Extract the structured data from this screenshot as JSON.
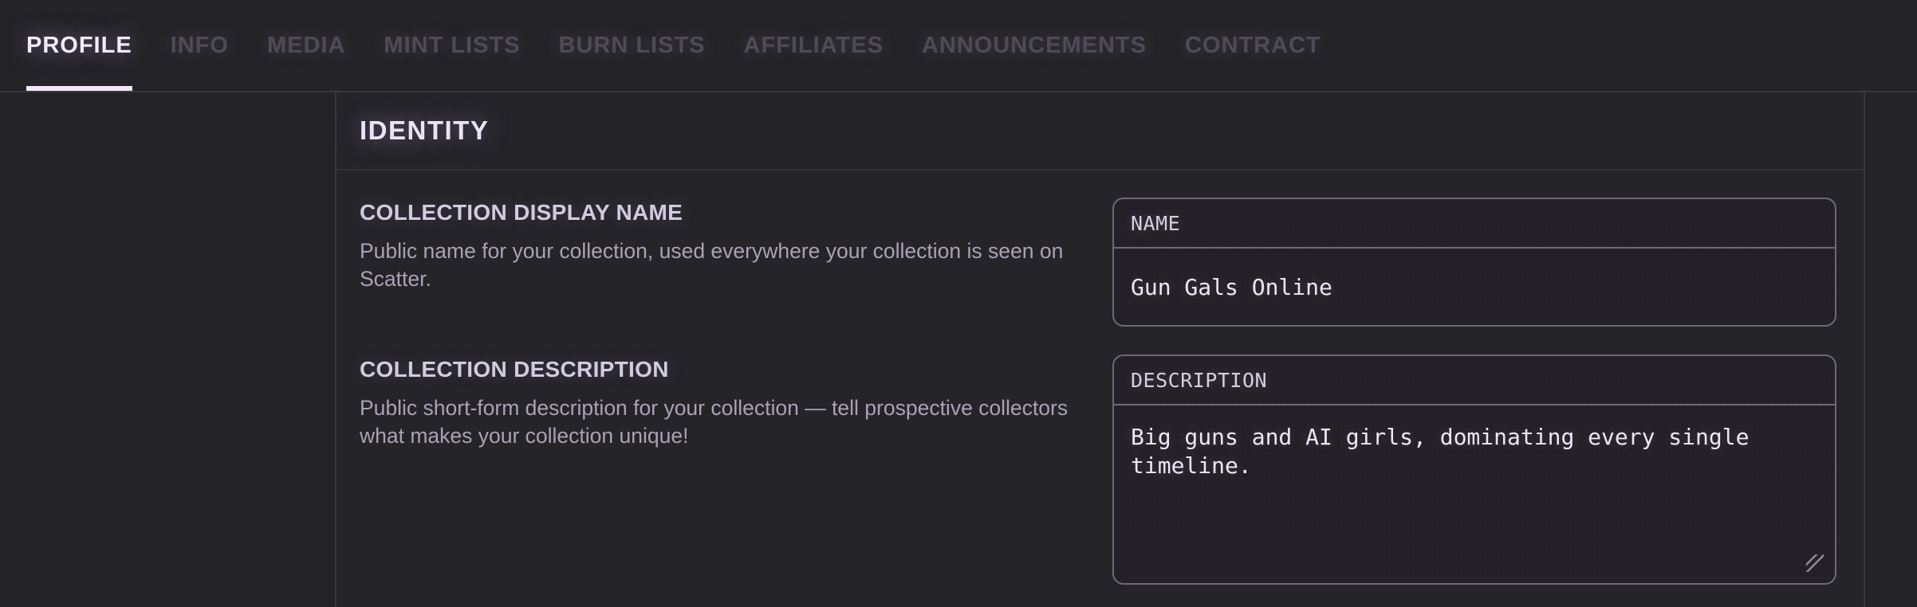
{
  "nav": {
    "tabs": [
      {
        "label": "PROFILE",
        "active": true
      },
      {
        "label": "INFO",
        "active": false
      },
      {
        "label": "MEDIA",
        "active": false
      },
      {
        "label": "MINT LISTS",
        "active": false
      },
      {
        "label": "BURN LISTS",
        "active": false
      },
      {
        "label": "AFFILIATES",
        "active": false
      },
      {
        "label": "ANNOUNCEMENTS",
        "active": false
      },
      {
        "label": "CONTRACT",
        "active": false
      }
    ]
  },
  "section": {
    "title": "IDENTITY"
  },
  "fields": [
    {
      "heading": "COLLECTION DISPLAY NAME",
      "help": "Public name for your collection, used everywhere your collection is seen on Scatter.",
      "input_label": "NAME",
      "value": "Gun Gals Online"
    },
    {
      "heading": "COLLECTION DESCRIPTION",
      "help": "Public short-form description for your collection — tell prospective collectors what makes your collection unique!",
      "input_label": "DESCRIPTION",
      "value": "Big guns and AI girls, dominating every single timeline."
    }
  ],
  "colors": {
    "background": "#242327",
    "panel_border": "#39383e",
    "field_border": "#6c6a74",
    "active_tab_text": "#f1ebfb",
    "inactive_tab_text": "#4e4b56",
    "active_tab_underline": "#f0eafa",
    "section_title_text": "#e9e3f5",
    "field_heading_text": "#d2cbe0",
    "help_text": "#a9a2b5",
    "mono_label_text": "#d5cfe1",
    "mono_value_text": "#ece6f6"
  }
}
